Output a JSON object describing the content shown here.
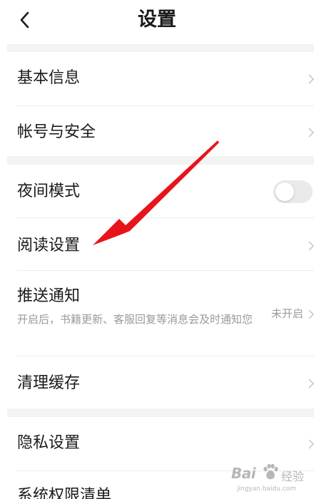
{
  "header": {
    "title": "设置",
    "back_icon": "chevron-left-icon"
  },
  "sections": [
    {
      "items": [
        {
          "label": "基本信息",
          "control": "chevron"
        },
        {
          "label": "帐号与安全",
          "control": "chevron"
        }
      ]
    },
    {
      "items": [
        {
          "label": "夜间模式",
          "control": "toggle",
          "toggle_on": false
        },
        {
          "label": "阅读设置",
          "control": "chevron"
        },
        {
          "label": "推送通知",
          "description": "开启后，书籍更新、客服回复等消息会及时通知您",
          "value": "未开启",
          "control": "chevron"
        },
        {
          "label": "清理缓存",
          "control": "chevron"
        }
      ]
    },
    {
      "items": [
        {
          "label": "隐私设置",
          "control": "chevron"
        },
        {
          "label": "系统权限清单",
          "control": "chevron"
        }
      ]
    }
  ],
  "annotation": {
    "type": "red-arrow",
    "points_to": "阅读设置",
    "color": "#e8141b"
  },
  "watermark": {
    "logo": "Bai",
    "text": "经验",
    "url": "jingyan.baidu.com"
  },
  "colors": {
    "background": "#ffffff",
    "section_gap": "#f3f3f3",
    "text": "#1a1a1a",
    "secondary_text": "#9a9a9a",
    "toggle_off": "#eaeaea",
    "arrow": "#e8141b"
  }
}
